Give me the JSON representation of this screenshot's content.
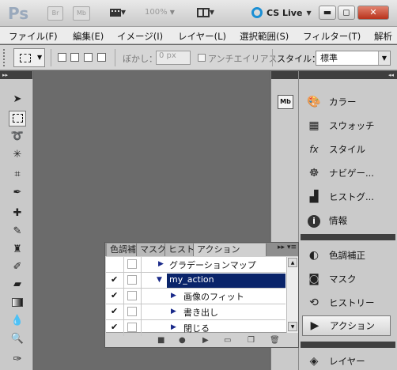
{
  "appbar": {
    "logo": "Ps",
    "bridge_button": "Br",
    "minibridge_button": "Mb",
    "zoom": "100%",
    "cslive": "CS Live"
  },
  "menu": [
    "ファイル(F)",
    "編集(E)",
    "イメージ(I)",
    "レイヤー(L)",
    "選択範囲(S)",
    "フィルター(T)",
    "解析"
  ],
  "options": {
    "feather_label": "ぼかし：",
    "feather_value": "0 px",
    "antialias_label": "アンチエイリアス",
    "style_label": "スタイル：",
    "style_value": "標準"
  },
  "mini_dock": {
    "mb_label": "Mb"
  },
  "dock": {
    "items": [
      {
        "label": "カラー",
        "icon": "palette-icon"
      },
      {
        "label": "スウォッチ",
        "icon": "swatches-icon"
      },
      {
        "label": "スタイル",
        "icon": "styles-icon"
      },
      {
        "label": "ナビゲー...",
        "icon": "navigator-icon"
      },
      {
        "label": "ヒストグ...",
        "icon": "histogram-icon"
      },
      {
        "label": "情報",
        "icon": "info-icon"
      }
    ],
    "items2": [
      {
        "label": "色調補正",
        "icon": "adjustments-icon"
      },
      {
        "label": "マスク",
        "icon": "masks-icon"
      },
      {
        "label": "ヒストリー",
        "icon": "history-icon"
      },
      {
        "label": "アクション",
        "icon": "actions-icon",
        "active": true
      }
    ],
    "items3": [
      {
        "label": "レイヤー",
        "icon": "layers-icon"
      }
    ]
  },
  "actions_panel": {
    "tabs": [
      "色調補",
      "マスク",
      "ヒスト",
      "アクション"
    ],
    "rows": [
      {
        "checked": false,
        "label": "グラデーションマップ",
        "level": 1,
        "expanded": false
      },
      {
        "checked": true,
        "label": "my_action",
        "level": 1,
        "expanded": true,
        "selected": true
      },
      {
        "checked": true,
        "label": "画像のフィット",
        "level": 2,
        "expanded": false
      },
      {
        "checked": true,
        "label": "書き出し",
        "level": 2,
        "expanded": false
      },
      {
        "checked": true,
        "label": "閉じる",
        "level": 2,
        "expanded": false
      }
    ]
  }
}
